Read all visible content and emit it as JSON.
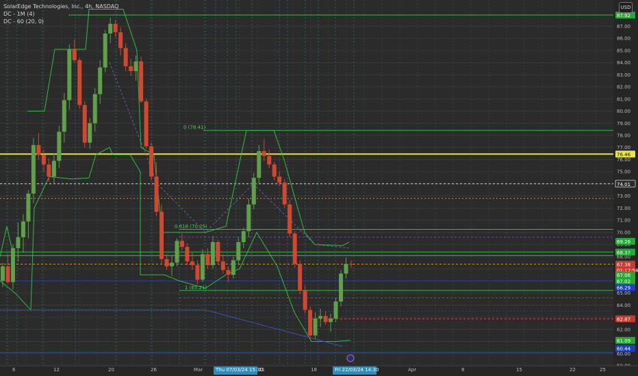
{
  "legend": {
    "title": "SolarEdge Technologies, Inc., 4h, NASDAQ",
    "line2": "DC - 1M (4)",
    "line3": "DC - 60 (20, 0)"
  },
  "currency": "USD",
  "price_axis": {
    "min": 59.0,
    "max": 88.6,
    "ticks": [
      "59.00",
      "60.00",
      "61.00",
      "62.00",
      "63.00",
      "64.00",
      "65.00",
      "66.00",
      "67.00",
      "68.00",
      "69.00",
      "70.00",
      "71.00",
      "72.00",
      "73.00",
      "74.00",
      "75.00",
      "76.00",
      "77.00",
      "78.00",
      "79.00",
      "80.00",
      "81.00",
      "82.00",
      "83.00",
      "84.00",
      "85.00",
      "86.00",
      "87.00"
    ]
  },
  "time_axis": {
    "labels": [
      "6",
      "12",
      "20",
      "26",
      "Mar",
      "11",
      "18",
      "Apr",
      "8",
      "15",
      "22",
      "25"
    ],
    "hover_labels": [
      "Thu 07/03/24   15:30",
      "Fri 22/03/24   14:30"
    ]
  },
  "price_tags": [
    {
      "text": "87.92",
      "value": 87.92,
      "color": "#22aa33"
    },
    {
      "text": "76.46",
      "value": 76.46,
      "color": "#e6e64a",
      "text_color": "#111111"
    },
    {
      "text": "74.01",
      "value": 74.01,
      "color": "#2a2a2a",
      "text_color": "#ffffff"
    },
    {
      "text": "69.26",
      "value": 69.26,
      "color": "#22aa33"
    },
    {
      "text": "68.37",
      "value": 68.37,
      "color": "#22aa33"
    },
    {
      "text": "67.38",
      "value": 67.38,
      "color": "#c83a2a"
    },
    {
      "text": "01:17:58",
      "value": 66.9,
      "color": "#c83a2a"
    },
    {
      "text": "67.06",
      "value": 66.5,
      "color": "#22aa33"
    },
    {
      "text": "67.02",
      "value": 66.0,
      "color": "#22aa33"
    },
    {
      "text": "66.29",
      "value": 65.45,
      "color": "#1f3fbf"
    },
    {
      "text": "62.87",
      "value": 62.87,
      "color": "#c83a2a"
    },
    {
      "text": "61.09",
      "value": 61.09,
      "color": "#22aa33"
    },
    {
      "text": "60.44",
      "value": 60.44,
      "color": "#1f3fbf"
    }
  ],
  "fib_labels": [
    {
      "text": "0 (78.41)",
      "value": 78.41
    },
    {
      "text": "0.618 (70.25)",
      "value": 70.25
    },
    {
      "text": "1 (65.21)",
      "value": 65.21
    }
  ],
  "chart_data": {
    "type": "candlestick",
    "candles": [
      [
        66,
        67.5,
        65.5,
        67.2
      ],
      [
        67.2,
        68.2,
        65.8,
        65.9
      ],
      [
        65.9,
        69.0,
        65.3,
        68.7
      ],
      [
        68.7,
        70.8,
        67.6,
        69.6
      ],
      [
        69.6,
        71.5,
        68.3,
        70.9
      ],
      [
        70.9,
        73.5,
        69.5,
        73.2
      ],
      [
        73.2,
        77.8,
        72.4,
        77.2
      ],
      [
        77.2,
        78.2,
        76.0,
        76.4
      ],
      [
        76.4,
        76.8,
        75.0,
        75.6
      ],
      [
        75.6,
        76.1,
        74.2,
        74.6
      ],
      [
        74.6,
        76.5,
        74.0,
        75.9
      ],
      [
        75.9,
        78.8,
        75.3,
        78.3
      ],
      [
        78.3,
        81.5,
        77.4,
        80.9
      ],
      [
        80.9,
        85.5,
        80.1,
        85.1
      ],
      [
        85.1,
        85.9,
        84.0,
        84.2
      ],
      [
        84.2,
        84.4,
        80.2,
        80.5
      ],
      [
        80.5,
        80.8,
        77.0,
        77.4
      ],
      [
        77.4,
        79.4,
        76.9,
        79.0
      ],
      [
        79.0,
        81.9,
        78.3,
        81.4
      ],
      [
        81.4,
        84.2,
        80.6,
        83.6
      ],
      [
        83.6,
        86.7,
        83.2,
        86.4
      ],
      [
        86.4,
        87.7,
        85.6,
        87.2
      ],
      [
        87.2,
        87.5,
        86.1,
        86.5
      ],
      [
        86.5,
        86.9,
        84.6,
        85.2
      ],
      [
        85.2,
        85.6,
        83.3,
        83.7
      ],
      [
        83.7,
        84.3,
        82.9,
        83.3
      ],
      [
        83.3,
        84.6,
        82.5,
        84.1
      ],
      [
        84.1,
        84.5,
        80.7,
        80.8
      ],
      [
        80.8,
        81.0,
        76.9,
        77.1
      ],
      [
        77.1,
        77.4,
        74.3,
        74.6
      ],
      [
        74.6,
        75.8,
        71.3,
        71.7
      ],
      [
        71.7,
        72.3,
        67.4,
        67.8
      ],
      [
        67.8,
        68.2,
        66.9,
        67.2
      ],
      [
        67.2,
        68.1,
        66.4,
        67.5
      ],
      [
        67.5,
        69.5,
        67.2,
        69.3
      ],
      [
        69.3,
        69.9,
        68.5,
        68.8
      ],
      [
        68.8,
        69.1,
        67.3,
        67.6
      ],
      [
        67.6,
        68.3,
        66.9,
        67.3
      ],
      [
        67.3,
        67.7,
        65.7,
        66.1
      ],
      [
        66.1,
        68.6,
        65.9,
        68.2
      ],
      [
        68.2,
        68.7,
        67.0,
        67.3
      ],
      [
        67.3,
        69.7,
        67.0,
        69.2
      ],
      [
        69.2,
        69.4,
        67.4,
        67.6
      ],
      [
        67.6,
        68.2,
        66.6,
        66.9
      ],
      [
        66.9,
        67.2,
        65.9,
        66.5
      ],
      [
        66.5,
        68.0,
        66.2,
        67.7
      ],
      [
        67.7,
        69.6,
        67.3,
        69.2
      ],
      [
        69.2,
        70.4,
        68.7,
        70.1
      ],
      [
        70.1,
        72.8,
        69.6,
        72.3
      ],
      [
        72.3,
        74.9,
        71.9,
        74.5
      ],
      [
        74.5,
        77.2,
        74.0,
        76.7
      ],
      [
        76.7,
        77.7,
        75.9,
        76.3
      ],
      [
        76.3,
        76.8,
        75.3,
        75.6
      ],
      [
        75.6,
        75.8,
        74.3,
        74.6
      ],
      [
        74.6,
        75.0,
        73.8,
        74.1
      ],
      [
        74.1,
        74.4,
        72.0,
        72.3
      ],
      [
        72.3,
        72.7,
        69.6,
        69.9
      ],
      [
        69.9,
        70.1,
        67.1,
        67.4
      ],
      [
        67.4,
        67.7,
        64.9,
        65.2
      ],
      [
        65.2,
        65.6,
        63.3,
        63.6
      ],
      [
        63.6,
        63.9,
        61.2,
        61.5
      ],
      [
        61.5,
        63.4,
        61.2,
        62.9
      ],
      [
        62.9,
        63.7,
        62.2,
        63.1
      ],
      [
        63.1,
        63.5,
        62.4,
        62.6
      ],
      [
        62.6,
        63.3,
        61.8,
        62.9
      ],
      [
        62.9,
        64.6,
        62.6,
        64.3
      ],
      [
        64.3,
        66.9,
        63.9,
        66.6
      ],
      [
        66.6,
        67.9,
        66.2,
        67.4
      ],
      [
        67.4,
        67.7,
        67.1,
        67.38
      ]
    ]
  }
}
